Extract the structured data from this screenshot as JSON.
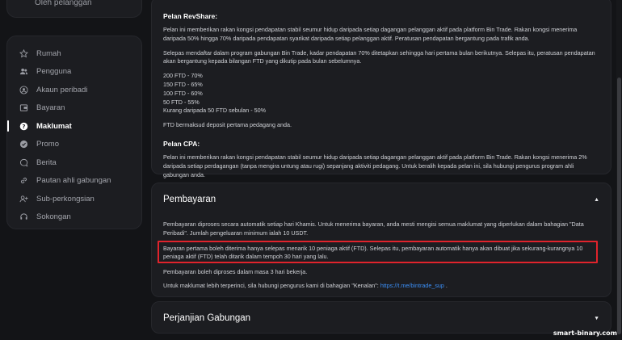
{
  "sidebar_top": {
    "label": "Oleh pelanggan"
  },
  "sidebar": {
    "items": [
      {
        "label": "Rumah",
        "icon": "star-icon"
      },
      {
        "label": "Pengguna",
        "icon": "users-icon"
      },
      {
        "label": "Akaun peribadi",
        "icon": "user-circle-icon"
      },
      {
        "label": "Bayaran",
        "icon": "wallet-icon"
      },
      {
        "label": "Maklumat",
        "icon": "question-icon",
        "active": true
      },
      {
        "label": "Promo",
        "icon": "badge-icon"
      },
      {
        "label": "Berita",
        "icon": "chat-icon"
      },
      {
        "label": "Pautan ahli gabungan",
        "icon": "link-icon"
      },
      {
        "label": "Sub-perkongsian",
        "icon": "user-plus-icon"
      },
      {
        "label": "Sokongan",
        "icon": "headset-icon"
      }
    ]
  },
  "revshare": {
    "title": "Pelan RevShare:",
    "p1": "Pelan ini memberikan rakan kongsi pendapatan stabil seumur hidup daripada setiap dagangan pelanggan aktif pada platform Bin Trade. Rakan kongsi menerima daripada 50% hingga 70% daripada pendapatan syarikat daripada setiap pelanggan aktif. Peratusan pendapatan bergantung pada trafik anda.",
    "p2": "Selepas mendaftar dalam program gabungan Bin Trade, kadar pendapatan 70% ditetapkan sehingga hari pertama bulan berikutnya. Selepas itu, peratusan pendapatan akan bergantung kepada bilangan FTD yang dikutip pada bulan sebelumnya.",
    "tiers": [
      "200 FTD - 70%",
      "150 FTD - 65%",
      "100 FTD - 60%",
      "50 FTD - 55%",
      "Kurang daripada 50 FTD sebulan - 50%"
    ],
    "note": "FTD bermaksud deposit pertama pedagang anda."
  },
  "cpa": {
    "title": "Pelan CPA:",
    "p1": "Pelan ini memberikan rakan kongsi pendapatan stabil seumur hidup daripada setiap dagangan pelanggan aktif pada platform Bin Trade. Rakan kongsi menerima 2% daripada setiap perdagangan (tanpa mengira untung atau rugi) sepanjang aktiviti pedagang. Untuk beralih kepada pelan ini, sila hubungi pengurus program ahli gabungan anda."
  },
  "payment": {
    "title": "Pembayaran",
    "p1": "Pembayaran diproses secara automatik setiap hari Khamis. Untuk menerima bayaran, anda mesti mengisi semua maklumat yang diperlukan dalam bahagian \"Data Peribadi\". Jumlah pengeluaran minimum ialah 10 USDT.",
    "p2": "Bayaran pertama boleh diterima hanya selepas menarik 10 peniaga aktif (FTD). Selepas itu, pembayaran automatik hanya akan dibuat jika sekurang-kurangnya 10 peniaga aktif (FTD) telah ditarik dalam tempoh 30 hari yang lalu.",
    "p3": "Pembayaran boleh diproses dalam masa 3 hari bekerja.",
    "p4_prefix": "Untuk maklumat lebih terperinci, sila hubungi pengurus kami di bahagian \"Kenalan\": ",
    "p4_link": "https://t.me/bintrade_sup",
    "p4_suffix": " .",
    "caret": "▲"
  },
  "agreement": {
    "title": "Perjanjian Gabungan",
    "caret": "▼"
  },
  "watermark": "smart-binary.com",
  "colors": {
    "highlight": "#e0232c",
    "link": "#3b8ff7"
  }
}
